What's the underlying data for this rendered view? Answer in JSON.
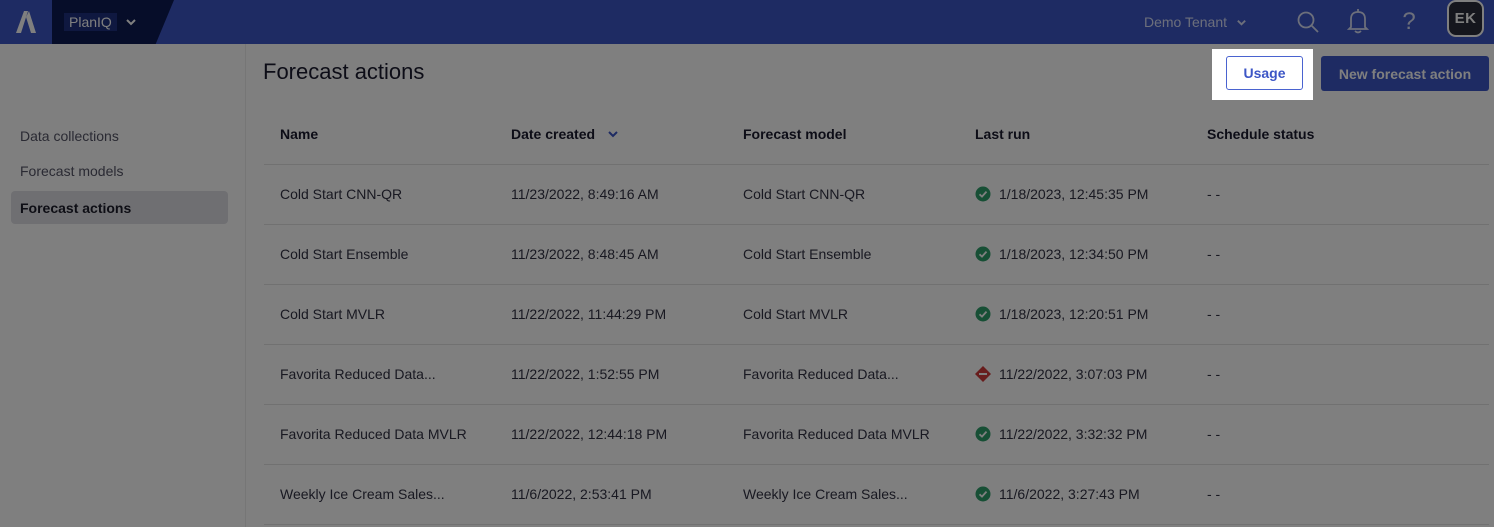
{
  "topbar": {
    "app_name": "PlanIQ",
    "tenant": "Demo Tenant",
    "avatar_initials": "EK",
    "brand_color": "#3d56c6"
  },
  "sidebar": {
    "items": [
      {
        "label": "Data collections",
        "active": false
      },
      {
        "label": "Forecast models",
        "active": false
      },
      {
        "label": "Forecast actions",
        "active": true
      }
    ]
  },
  "page": {
    "title": "Forecast actions",
    "usage_label": "Usage",
    "new_label": "New forecast action"
  },
  "table": {
    "columns": [
      "Name",
      "Date created",
      "Forecast model",
      "Last run",
      "Schedule status"
    ],
    "sort_column": "Date created",
    "sort_direction": "descending",
    "rows": [
      {
        "name": "Cold Start CNN-QR",
        "created": "11/23/2022, 8:49:16 AM",
        "model": "Cold Start CNN-QR",
        "last_run": "1/18/2023, 12:45:35 PM",
        "run_status": "success",
        "schedule": "- -"
      },
      {
        "name": "Cold Start Ensemble",
        "created": "11/23/2022, 8:48:45 AM",
        "model": "Cold Start Ensemble",
        "last_run": "1/18/2023, 12:34:50 PM",
        "run_status": "success",
        "schedule": "- -"
      },
      {
        "name": "Cold Start MVLR",
        "created": "11/22/2022, 11:44:29 PM",
        "model": "Cold Start MVLR",
        "last_run": "1/18/2023, 12:20:51 PM",
        "run_status": "success",
        "schedule": "- -"
      },
      {
        "name": "Favorita Reduced Data...",
        "created": "11/22/2022, 1:52:55 PM",
        "model": "Favorita Reduced Data...",
        "last_run": "11/22/2022, 3:07:03 PM",
        "run_status": "error",
        "schedule": "- -"
      },
      {
        "name": "Favorita Reduced Data MVLR",
        "created": "11/22/2022, 12:44:18 PM",
        "model": "Favorita Reduced Data MVLR",
        "last_run": "11/22/2022, 3:32:32 PM",
        "run_status": "success",
        "schedule": "- -"
      },
      {
        "name": "Weekly Ice Cream Sales...",
        "created": "11/6/2022, 2:53:41 PM",
        "model": "Weekly Ice Cream Sales...",
        "last_run": "11/6/2022, 3:27:43 PM",
        "run_status": "success",
        "schedule": "- -"
      }
    ]
  },
  "status_colors": {
    "success": "#2e9e6b",
    "error": "#d03a3a"
  }
}
